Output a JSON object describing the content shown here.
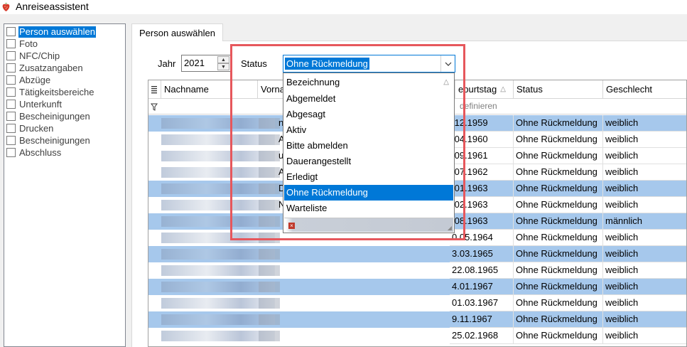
{
  "window": {
    "title": "Anreiseassistent",
    "icon": "strawberry-icon"
  },
  "sidebar": {
    "items": [
      {
        "label": "Person auswählen",
        "selected": true
      },
      {
        "label": "Foto"
      },
      {
        "label": "NFC/Chip"
      },
      {
        "label": "Zusatzangaben"
      },
      {
        "label": "Abzüge"
      },
      {
        "label": "Tätigkeitsbereiche"
      },
      {
        "label": "Unterkunft"
      },
      {
        "label": "Bescheinigungen"
      },
      {
        "label": "Drucken"
      },
      {
        "label": "Bescheinigungen"
      },
      {
        "label": "Abschluss"
      }
    ]
  },
  "tab": {
    "label": "Person auswählen"
  },
  "filters": {
    "year_label": "Jahr",
    "year_value": "2021",
    "status_label": "Status",
    "status_value": "Ohne Rückmeldung"
  },
  "grid": {
    "columns": [
      "Nachname",
      "Vorna",
      "eburtstag",
      "Status",
      "Geschlecht"
    ],
    "filter_hint": "definieren",
    "rows": [
      {
        "name_frag": "n",
        "birthday": ".12.1959",
        "status": "Ohne Rückmeldung",
        "gender": "weiblich",
        "highlight": true
      },
      {
        "name_frag": "A",
        "birthday": ".04.1960",
        "status": "Ohne Rückmeldung",
        "gender": "weiblich",
        "highlight": false
      },
      {
        "name_frag": "ut",
        "birthday": ".09.1961",
        "status": "Ohne Rückmeldung",
        "gender": "weiblich",
        "highlight": false
      },
      {
        "name_frag": "AE",
        "birthday": ".07.1962",
        "status": "Ohne Rückmeldung",
        "gender": "weiblich",
        "highlight": false
      },
      {
        "name_frag": "D",
        "birthday": ".01.1963",
        "status": "Ohne Rückmeldung",
        "gender": "weiblich",
        "highlight": true
      },
      {
        "name_frag": "N",
        "birthday": ".02.1963",
        "status": "Ohne Rückmeldung",
        "gender": "weiblich",
        "highlight": false
      },
      {
        "name_frag": "",
        "birthday": ".08.1963",
        "status": "Ohne Rückmeldung",
        "gender": "männlich",
        "highlight": true
      },
      {
        "name_frag": "",
        "birthday": "0.05.1964",
        "status": "Ohne Rückmeldung",
        "gender": "weiblich",
        "highlight": false
      },
      {
        "name_frag": "",
        "birthday": "3.03.1965",
        "status": "Ohne Rückmeldung",
        "gender": "weiblich",
        "highlight": true
      },
      {
        "name_frag": "",
        "birthday": "22.08.1965",
        "status": "Ohne Rückmeldung",
        "gender": "weiblich",
        "highlight": false
      },
      {
        "name_frag": "",
        "birthday": "4.01.1967",
        "status": "Ohne Rückmeldung",
        "gender": "weiblich",
        "highlight": true
      },
      {
        "name_frag": "",
        "birthday": "01.03.1967",
        "status": "Ohne Rückmeldung",
        "gender": "weiblich",
        "highlight": false
      },
      {
        "name_frag": "",
        "birthday": "9.11.1967",
        "status": "Ohne Rückmeldung",
        "gender": "weiblich",
        "highlight": true
      },
      {
        "name_frag": "",
        "birthday": "25.02.1968",
        "status": "Ohne Rückmeldung",
        "gender": "weiblich",
        "highlight": false
      }
    ]
  },
  "dropdown": {
    "items": [
      {
        "label": "Bezeichnung",
        "header": true
      },
      {
        "label": "Abgemeldet"
      },
      {
        "label": "Abgesagt"
      },
      {
        "label": "Aktiv"
      },
      {
        "label": "Bitte abmelden"
      },
      {
        "label": "Dauerangestellt"
      },
      {
        "label": "Erledigt"
      },
      {
        "label": "Ohne Rückmeldung",
        "active": true
      },
      {
        "label": "Warteliste"
      }
    ]
  },
  "colors": {
    "accent": "#0078d7",
    "row_highlight": "#a6c8ec",
    "annotation": "#e6575c"
  }
}
